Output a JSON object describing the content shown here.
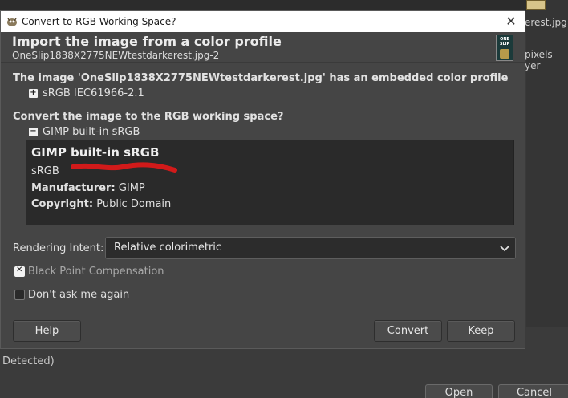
{
  "background": {
    "right_text_lines": [
      "erest.jpg",
      "pixels",
      "yer"
    ],
    "detected_text": "Detected)",
    "open_label": "Open",
    "cancel_label": "Cancel"
  },
  "dialog": {
    "window_title": "Convert to RGB Working Space?",
    "header_title": "Import the image from a color profile",
    "header_subtitle": "OneSlip1838X2775NEWtestdarkerest.jpg-2",
    "preview_text": "ONE SLIP",
    "embedded_message": "The image 'OneSlip1838X2775NEWtestdarkerest.jpg' has an embedded color profile",
    "embedded_profile": "sRGB IEC61966-2.1",
    "convert_question": "Convert the image to the RGB working space?",
    "target_profile": "GIMP built-in sRGB",
    "profile_details": {
      "name": "GIMP built-in sRGB",
      "description": "sRGB",
      "manufacturer_label": "Manufacturer:",
      "manufacturer_value": "GIMP",
      "copyright_label": "Copyright:",
      "copyright_value": "Public Domain"
    },
    "rendering_intent_label": "Rendering Intent:",
    "rendering_intent_value": "Relative colorimetric",
    "black_point_label": "Black Point Compensation",
    "black_point_checked": true,
    "dont_ask_label": "Don't ask me again",
    "dont_ask_checked": false,
    "buttons": {
      "help": "Help",
      "convert": "Convert",
      "keep": "Keep"
    }
  },
  "colors": {
    "annotation_red": "#d11a1a"
  }
}
